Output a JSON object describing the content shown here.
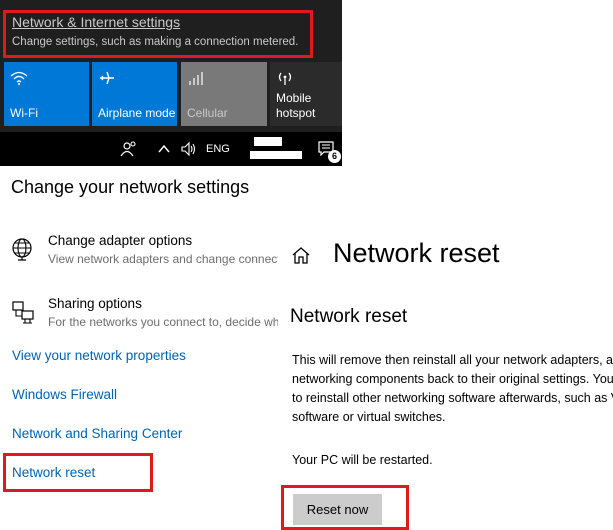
{
  "action_center": {
    "settings_link": "Network & Internet settings",
    "settings_subtitle": "Change settings, such as making a connection metered.",
    "tiles": [
      {
        "label": "Wi-Fi",
        "icon": "wifi-icon",
        "state": "on"
      },
      {
        "label": "Airplane mode",
        "icon": "airplane-icon",
        "state": "on"
      },
      {
        "label": "Cellular",
        "icon": "cellular-icon",
        "state": "disabled"
      },
      {
        "label_line1": "Mobile",
        "label_line2": "hotspot",
        "icon": "hotspot-icon",
        "state": "off"
      }
    ]
  },
  "taskbar": {
    "language": "ENG",
    "notification_count": "6"
  },
  "change_network_settings": {
    "title": "Change your network settings",
    "options": [
      {
        "title": "Change adapter options",
        "subtitle": "View network adapters and change connection settings."
      },
      {
        "title": "Sharing options",
        "subtitle": "For the networks you connect to, decide what you want to share."
      }
    ],
    "links": [
      "View your network properties",
      "Windows Firewall",
      "Network and Sharing Center",
      "Network reset"
    ]
  },
  "network_reset": {
    "page_title": "Network reset",
    "heading": "Network reset",
    "body_lines": [
      "This will remove then reinstall all your network adapters, and set other",
      "networking components back to their original settings. You might need",
      "to reinstall other networking software afterwards, such as VPN client",
      "software or virtual switches."
    ],
    "restart_note": "Your PC will be restarted.",
    "reset_button": "Reset now"
  },
  "colors": {
    "accent": "#0078d7",
    "link": "#0063b1",
    "highlight": "#e0191f",
    "panel_bg": "#1f1f1f"
  }
}
